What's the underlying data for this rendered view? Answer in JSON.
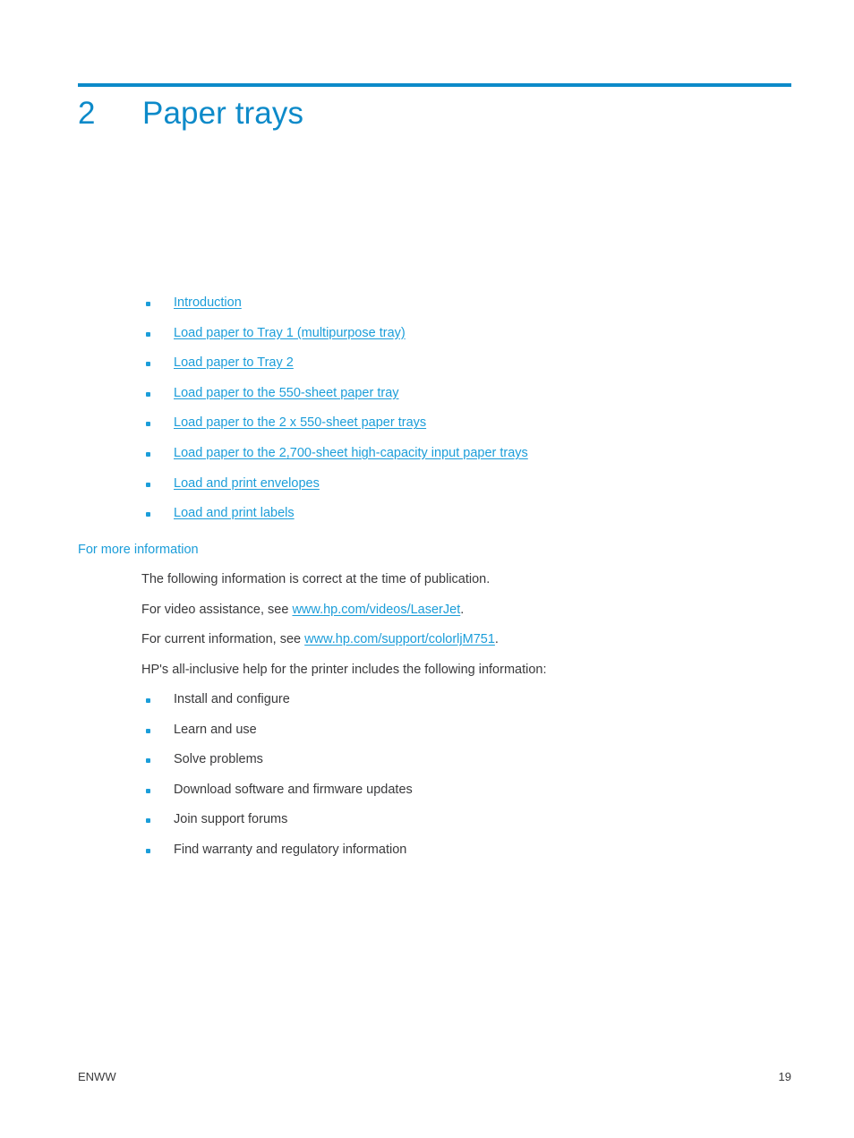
{
  "chapter": {
    "number": "2",
    "title": "Paper trays",
    "accent_color": "#0d8ac9"
  },
  "toc": {
    "links": [
      "Introduction",
      "Load paper to Tray 1 (multipurpose tray)",
      "Load paper to Tray 2",
      "Load paper to the 550-sheet paper tray",
      "Load paper to the 2 x 550-sheet paper trays",
      "Load paper to the 2,700-sheet high-capacity input paper trays",
      "Load and print envelopes",
      "Load and print labels"
    ],
    "link_color": "#1b9dd9",
    "bullet_color": "#1b9dd9"
  },
  "section": {
    "heading": "For more information",
    "heading_color": "#1b9dd9",
    "paragraphs": {
      "p1": "The following information is correct at the time of publication.",
      "p2_prefix": "For video assistance, see ",
      "p2_link": "www.hp.com/videos/LaserJet",
      "p2_suffix": ".",
      "p3_prefix": "For current information, see ",
      "p3_link": "www.hp.com/support/colorljM751",
      "p3_suffix": ".",
      "p4": "HP's all-inclusive help for the printer includes the following information:"
    },
    "help_items": [
      "Install and configure",
      "Learn and use",
      "Solve problems",
      "Download software and firmware updates",
      "Join support forums",
      "Find warranty and regulatory information"
    ]
  },
  "footer": {
    "locale": "ENWW",
    "page_number": "19"
  }
}
